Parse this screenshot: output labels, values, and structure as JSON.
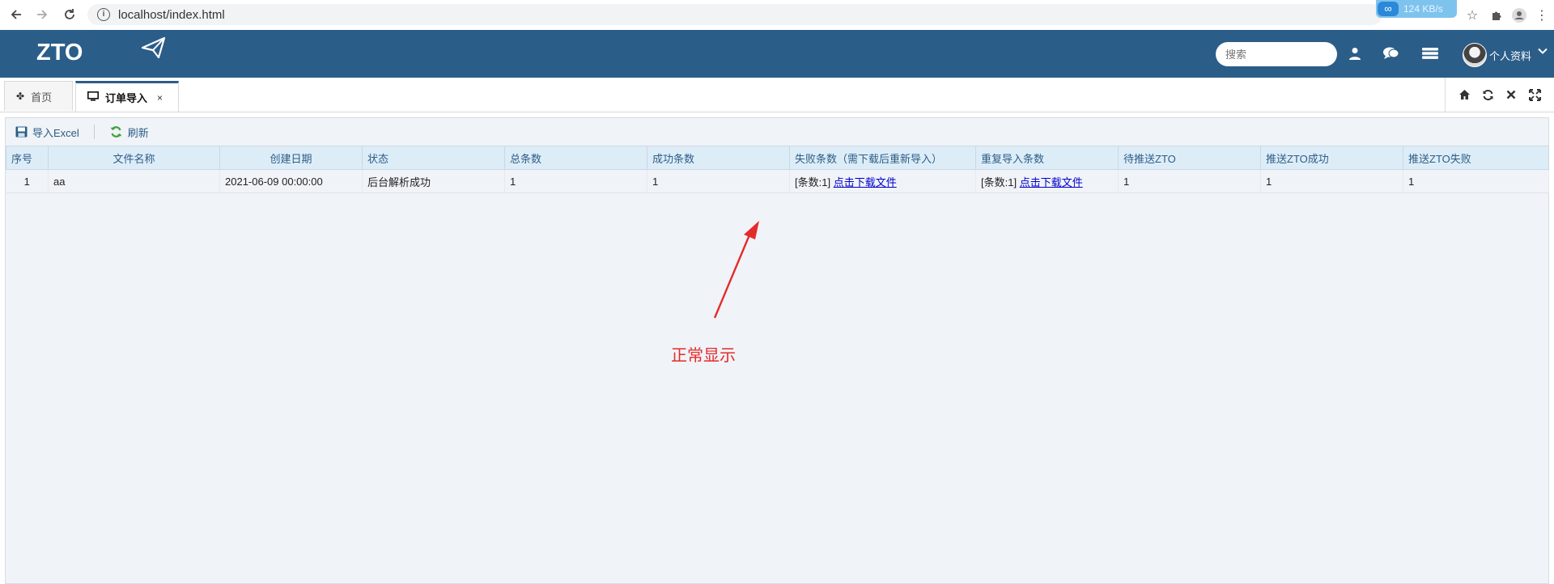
{
  "browser": {
    "url": "localhost/index.html",
    "download_speed": "124 KB/s"
  },
  "header": {
    "logo": "ZTO",
    "search_placeholder": "搜索",
    "profile_label": "个人资料"
  },
  "tabs": [
    {
      "label": "首页",
      "icon": "android-icon",
      "active": false
    },
    {
      "label": "订单导入",
      "icon": "monitor-icon",
      "active": true,
      "close": "×"
    }
  ],
  "toolbar": {
    "import_label": "导入Excel",
    "refresh_label": "刷新"
  },
  "table": {
    "columns": [
      "序号",
      "文件名称",
      "创建日期",
      "状态",
      "总条数",
      "成功条数",
      "失败条数（需下载后重新导入）",
      "重复导入条数",
      "待推送ZTO",
      "推送ZTO成功",
      "推送ZTO失败"
    ],
    "rows": [
      {
        "index": "1",
        "filename": "aa",
        "created": "2021-06-09 00:00:00",
        "status": "后台解析成功",
        "total": "1",
        "success": "1",
        "fail_prefix": "[条数:1] ",
        "fail_link": "点击下载文件",
        "dup_prefix": "[条数:1] ",
        "dup_link": "点击下载文件",
        "pending": "1",
        "pushed_ok": "1",
        "pushed_fail": "1"
      }
    ]
  },
  "annotation": {
    "text": "正常显示",
    "color": "#e52a2a"
  },
  "colors": {
    "header_bg": "#2b5d89",
    "table_header_bg": "#ddedf8",
    "panel_bg": "#f0f3f7"
  }
}
